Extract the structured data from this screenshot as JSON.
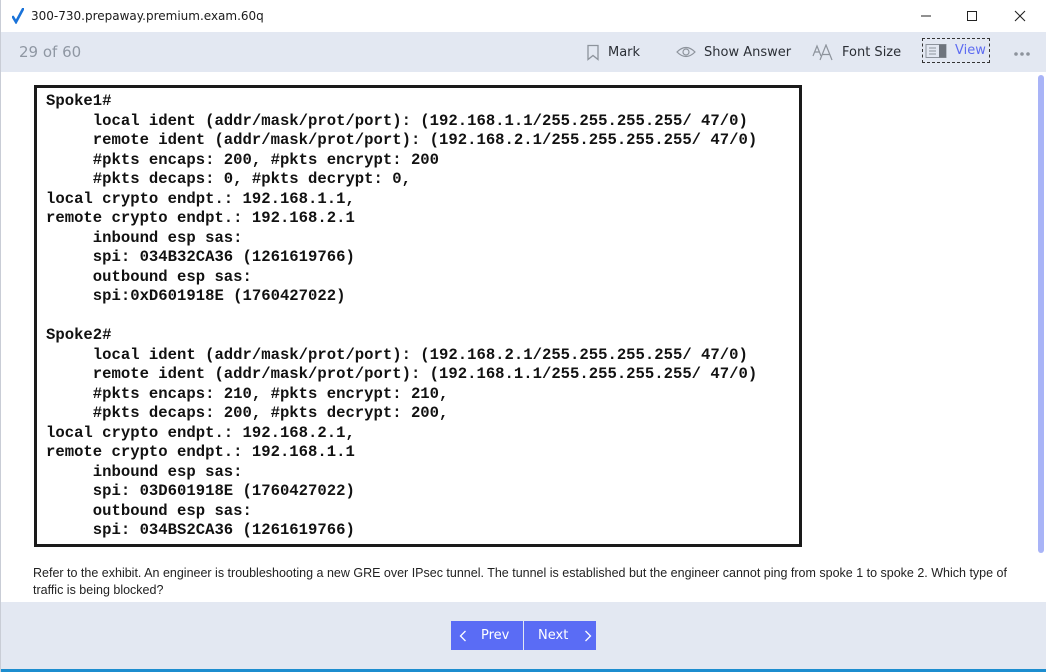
{
  "window": {
    "title": "300-730.prepaway.premium.exam.60q",
    "controls": [
      "minimize",
      "maximize",
      "close"
    ]
  },
  "toolbar": {
    "counter": "29 of 60",
    "mark_label": "Mark",
    "show_answer_label": "Show Answer",
    "font_size_label": "Font Size",
    "view_label": "View",
    "more_icon": "ellipsis-icon"
  },
  "exhibit": {
    "lines": [
      "Spoke1#",
      "     local ident (addr/mask/prot/port): (192.168.1.1/255.255.255.255/ 47/0)",
      "     remote ident (addr/mask/prot/port): (192.168.2.1/255.255.255.255/ 47/0)",
      "     #pkts encaps: 200, #pkts encrypt: 200",
      "     #pkts decaps: 0, #pkts decrypt: 0,",
      "local crypto endpt.: 192.168.1.1,",
      "remote crypto endpt.: 192.168.2.1",
      "     inbound esp sas:",
      "     spi: 034B32CA36 (1261619766)",
      "     outbound esp sas:",
      "     spi:0xD601918E (1760427022)",
      "",
      "Spoke2#",
      "     local ident (addr/mask/prot/port): (192.168.2.1/255.255.255.255/ 47/0)",
      "     remote ident (addr/mask/prot/port): (192.168.1.1/255.255.255.255/ 47/0)",
      "     #pkts encaps: 210, #pkts encrypt: 210,",
      "     #pkts decaps: 200, #pkts decrypt: 200,",
      "local crypto endpt.: 192.168.2.1,",
      "remote crypto endpt.: 192.168.1.1",
      "     inbound esp sas:",
      "     spi: 03D601918E (1760427022)",
      "     outbound esp sas:",
      "     spi: 034BS2CA36 (1261619766)"
    ]
  },
  "question": {
    "text": "Refer to the exhibit. An engineer is troubleshooting a new GRE over IPsec tunnel. The tunnel is established but the engineer cannot ping from spoke 1 to spoke 2. Which type of traffic is being blocked?"
  },
  "navigation": {
    "prev_label": "Prev",
    "next_label": "Next"
  },
  "colors": {
    "accent": "#5a6cf5",
    "toolbar_bg": "#e3e8f2",
    "view_text": "#5e6cf2",
    "counter_text": "#8f97a3",
    "scroll_thumb": "#a9b4f7"
  }
}
